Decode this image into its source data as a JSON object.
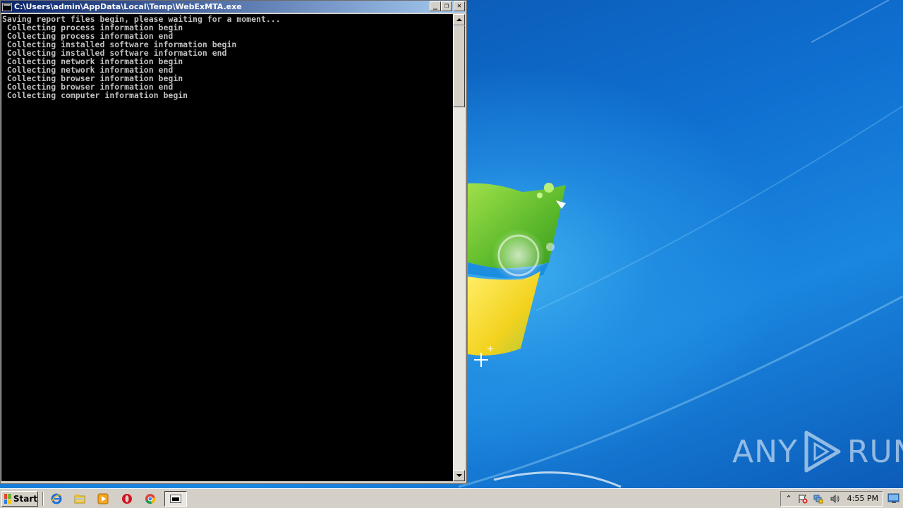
{
  "window": {
    "title": "C:\\Users\\admin\\AppData\\Local\\Temp\\WebExMTA.exe",
    "minimize_glyph": "_",
    "restore_glyph": "❐",
    "close_glyph": "✕",
    "console_lines": [
      "Saving report files begin, please waiting for a moment...",
      " Collecting process information begin",
      " Collecting process information end",
      " Collecting installed software information begin",
      " Collecting installed software information end",
      " Collecting network information begin",
      " Collecting network information end",
      " Collecting browser information begin",
      " Collecting browser information end",
      " Collecting computer information begin"
    ]
  },
  "taskbar": {
    "start_label": "Start",
    "quick_launch": [
      "ie-icon",
      "explorer-folder-icon",
      "media-player-icon",
      "opera-icon",
      "chrome-icon"
    ],
    "tray": {
      "expand_glyph": "⌃",
      "clock": "4:55 PM"
    }
  },
  "watermark": {
    "left_text": "ANY",
    "right_text": "RUN"
  },
  "colors": {
    "console_bg": "#000000",
    "console_text": "#c0c0c0",
    "titlebar_start": "#0a246a",
    "titlebar_end": "#a6caf0",
    "chrome": "#d4d0c8"
  }
}
